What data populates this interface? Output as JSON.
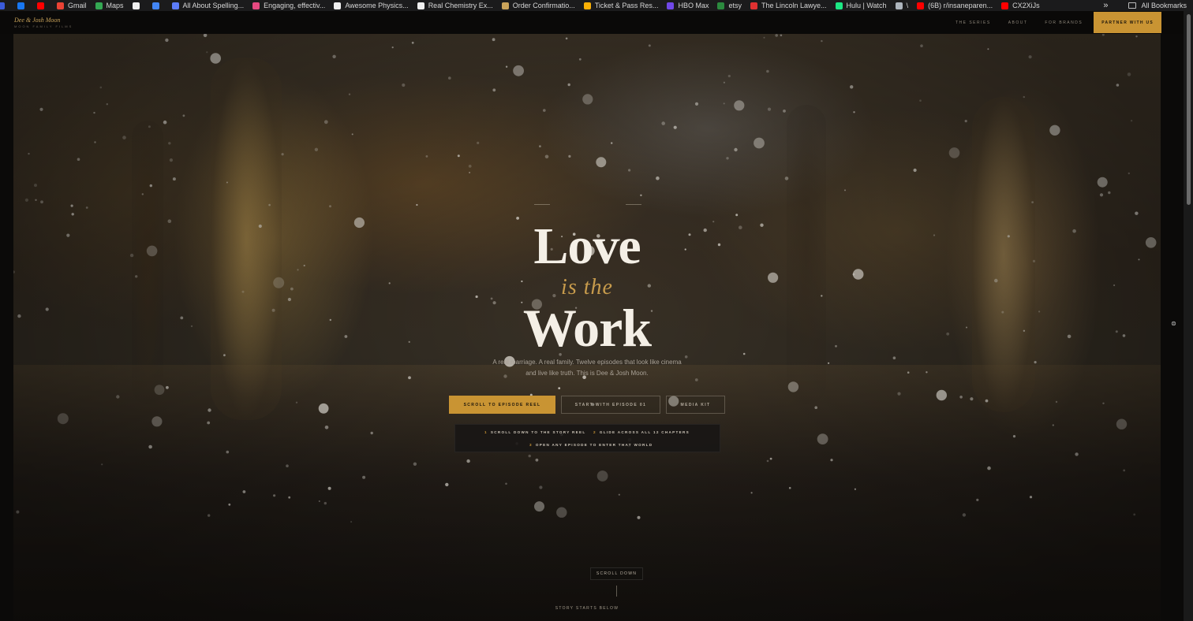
{
  "bookmarks": [
    {
      "label": "",
      "color": "#3b5bdb"
    },
    {
      "label": "",
      "color": "#1877f2"
    },
    {
      "label": "",
      "color": "#ff0000"
    },
    {
      "label": "Gmail",
      "color": "#ea4335"
    },
    {
      "label": "Maps",
      "color": "#34a853"
    },
    {
      "label": "",
      "color": "#f0f0f0"
    },
    {
      "label": "",
      "color": "#4285f4"
    },
    {
      "label": "All About Spelling...",
      "color": "#5c7cfa"
    },
    {
      "label": "Engaging, effectiv...",
      "color": "#e64980"
    },
    {
      "label": "Awesome Physics...",
      "color": "#f0f0f0"
    },
    {
      "label": "Real Chemistry Ex...",
      "color": "#f0f0f0"
    },
    {
      "label": "Order Confirmatio...",
      "color": "#c9a35a"
    },
    {
      "label": "Ticket & Pass Res...",
      "color": "#fab005"
    },
    {
      "label": "HBO Max",
      "color": "#7048e8"
    },
    {
      "label": "etsy",
      "color": "#2b8a3e"
    },
    {
      "label": "The Lincoln Lawye...",
      "color": "#e03131"
    },
    {
      "label": "Hulu | Watch",
      "color": "#1ce783"
    },
    {
      "label": "\\",
      "color": "#adb5bd"
    },
    {
      "label": "(6B) r/insaneparen...",
      "color": "#ff0000"
    },
    {
      "label": "CX2XiJs",
      "color": "#ff0000"
    }
  ],
  "bookmarks_overflow": "»",
  "all_bookmarks": "All Bookmarks",
  "site": {
    "logo_name": "Dee & Josh Moon",
    "logo_tag": "MOON FAMILY FILMS"
  },
  "nav": {
    "links": [
      "THE SERIES",
      "ABOUT",
      "FOR BRANDS"
    ],
    "cta": "PARTNER WITH US"
  },
  "hero": {
    "title_line1": "Love",
    "title_line2": "is the",
    "title_line3": "Work",
    "subtitle_line1": "A real marriage. A real family. Twelve episodes that look like cinema",
    "subtitle_line2": "and live like truth. This is Dee & Josh Moon.",
    "btn_reel": "SCROLL TO EPISODE REEL",
    "btn_episode": "START WITH EPISODE 01",
    "btn_kit": "MEDIA KIT",
    "steps": [
      {
        "num": "1",
        "text": "SCROLL DOWN TO THE STORY REEL"
      },
      {
        "num": "2",
        "text": "GLIDE ACROSS ALL 12 CHAPTERS"
      },
      {
        "num": "3",
        "text": "OPEN ANY EPISODE TO ENTER THAT WORLD"
      }
    ],
    "scroll_down": "SCROLL DOWN",
    "story_starts": "STORY STARTS BELOW"
  },
  "colors": {
    "accent": "#c99433",
    "gold_italic": "#c79b4c",
    "background": "#0b0a09"
  }
}
